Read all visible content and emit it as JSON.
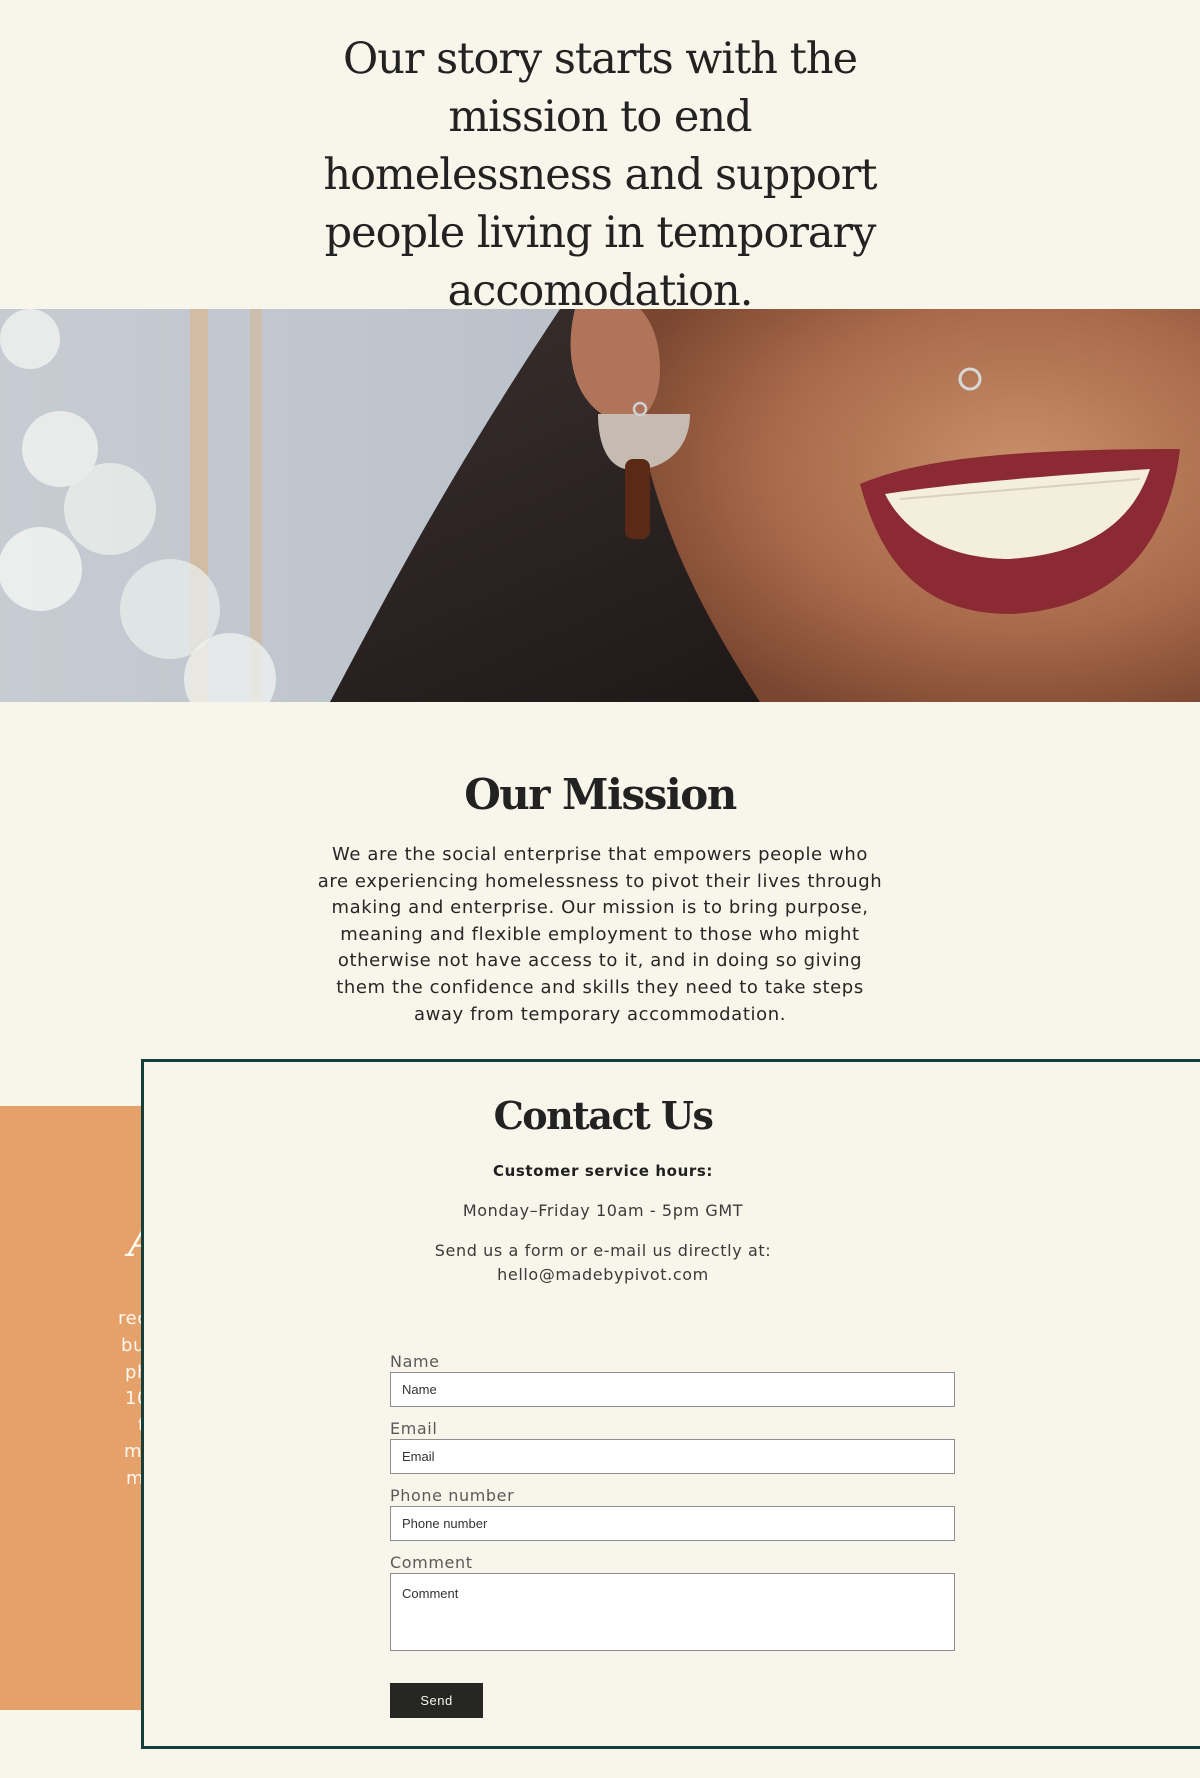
{
  "hero": {
    "heading": "Our story starts with the mission to end homelessness and support people living in temporary accomodation."
  },
  "mission": {
    "title": "Our Mission",
    "body": "We are the social enterprise that empowers people who are experiencing homelessness to pivot their lives through making and enterprise. Our mission is to bring purpose, meaning and flexible employment to those who might otherwise not have access to it, and in doing so giving them the confidence and skills they need to take steps away from temporary accommodation."
  },
  "partial_panel": {
    "title_fragment": "A",
    "lines": [
      "rec",
      "bu",
      "ph",
      "10",
      "t",
      "m",
      "m"
    ]
  },
  "contact": {
    "title": "Contact Us",
    "hours_label": "Customer service hours:",
    "hours_value": "Monday–Friday 10am - 5pm GMT",
    "send_note_line1": "Send us a form or e-mail us directly at:",
    "email": "hello@madebypivot.com",
    "form": {
      "name_label": "Name",
      "name_placeholder": "Name",
      "email_label": "Email",
      "email_placeholder": "Email",
      "phone_label": "Phone number",
      "phone_placeholder": "Phone number",
      "comment_label": "Comment",
      "comment_placeholder": "Comment",
      "send_label": "Send"
    }
  },
  "colors": {
    "background": "#f8f6ea",
    "accent_orange": "#e6a06a",
    "border_green": "#163f3a",
    "button_dark": "#262622"
  }
}
